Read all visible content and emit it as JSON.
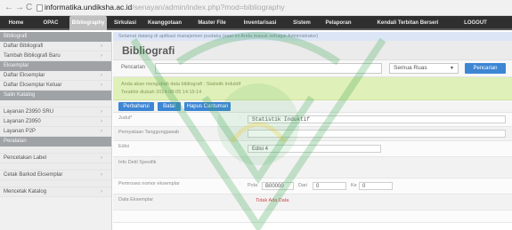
{
  "browser": {
    "back": "←",
    "forward": "→",
    "reload": "C",
    "url_host": "informatika.undiksha.ac.id",
    "url_path": "/senayan/admin/index.php?mod=bibliography"
  },
  "topmenu": [
    "Home",
    "OPAC",
    "Bibliography",
    "Sirkulasi",
    "Keanggotaan",
    "Master File",
    "Inventarisasi",
    "Sistem",
    "Pelaporan",
    "Kendali Terbitan Berseri",
    "LOGOUT"
  ],
  "sidebar": {
    "head1": "Bibliografi",
    "items1": [
      "Daftar Bibliografi",
      "Tambah Bibliografi Baru"
    ],
    "head2": "Eksemplar",
    "items2": [
      "Daftar Eksemplar",
      "Daftar Eksemplar Keluar"
    ],
    "head3": "Salin Katalog",
    "items3": [
      "Layanan Z3950 SRU",
      "Layanan Z3950",
      "Layanan P2P"
    ],
    "head4": "Peralatan",
    "items4": [
      "Pencetakan Label",
      "Cetak Barkod Eksemplar",
      "Mencetak Katalog"
    ]
  },
  "main": {
    "subbar": "Selamat datang di aplikasi manajemen pustaka (saat ini Anda masuk sebagai Administrator)",
    "title": "Bibliografi",
    "search_label": "Pencarian",
    "search_value": "",
    "search_scope": "Semua Ruas",
    "search_button": "Pencarian",
    "notice_line1": "Anda akan mengubah data bibliografi : Statistik Induktif",
    "notice_line2": "Terakhir diubah 2014-08-05 14:15:14",
    "btn_update": "Perbaharui",
    "btn_cancel": "Batal",
    "btn_delete": "Hapus Cantuman",
    "fields": {
      "judul_label": "Judul*",
      "judul_value": "Statistik Induktif",
      "pengarang_label": "Pernyataan Tanggungjawab",
      "pengarang_value": "",
      "edisi_label": "Edisi",
      "edisi_value": "Edisi 4",
      "info_label": "Info Detil Spesifik",
      "pola_label": "Pemroses nomor eksemplar",
      "pola_prefix": "Pola",
      "pola_value": "B00000",
      "dari_label": "Dari",
      "dari_value": "0",
      "ke_label": "Ke",
      "ke_value": "0",
      "data_label": "Data Eksemplar",
      "data_value": "Tidak Ada Data"
    }
  },
  "colors": {
    "topmenu_bg": "#2f2f2f",
    "accent_blue": "#3d86d4",
    "notice_bg": "#dff0b8",
    "watermark_green": "#3faa55"
  }
}
